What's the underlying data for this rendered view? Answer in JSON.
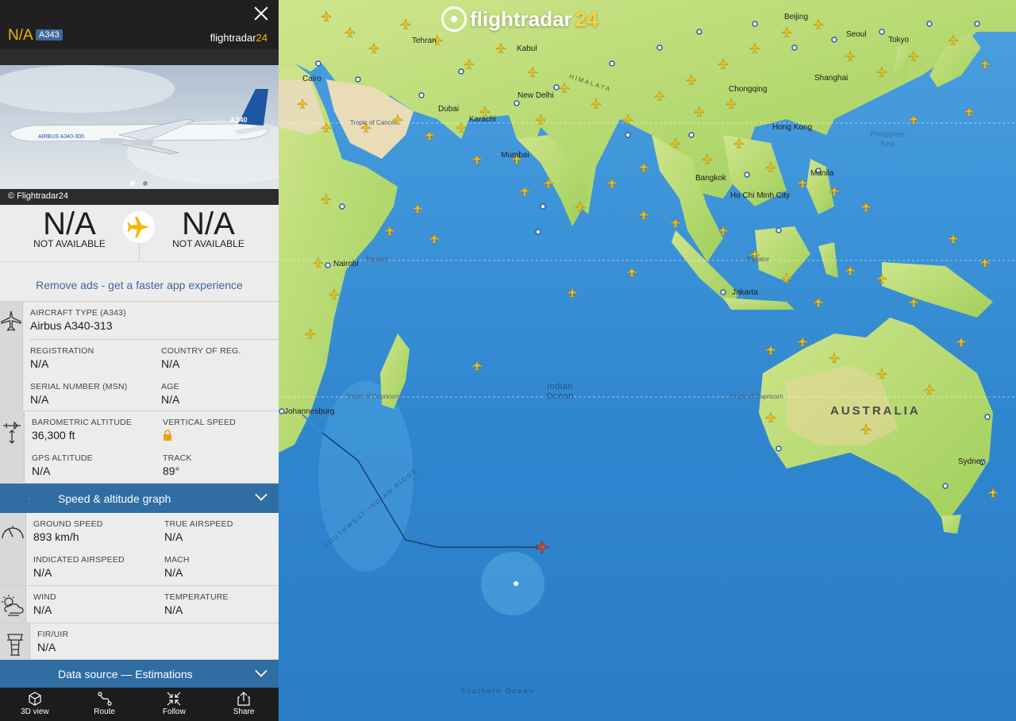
{
  "map": {
    "logo_text": "flightradar",
    "logo_num": "24",
    "cities": [
      {
        "name": "Tehran"
      },
      {
        "name": "Kabul"
      },
      {
        "name": "Cairo"
      },
      {
        "name": "Dubai"
      },
      {
        "name": "Karachi"
      },
      {
        "name": "New Delhi"
      },
      {
        "name": "Mumbai"
      },
      {
        "name": "Chongqing"
      },
      {
        "name": "Beijing"
      },
      {
        "name": "Seoul"
      },
      {
        "name": "Tokyo"
      },
      {
        "name": "Shanghai"
      },
      {
        "name": "Hong Kong"
      },
      {
        "name": "Manila"
      },
      {
        "name": "Bangkok"
      },
      {
        "name": "Ho Chi Minh City"
      },
      {
        "name": "Jakarta"
      },
      {
        "name": "Nairobi"
      },
      {
        "name": "Johannesburg"
      },
      {
        "name": "Sydney"
      }
    ],
    "oceans": {
      "indian": "Indian\nOcean",
      "southern": "Southern Ocean",
      "philippine": "Philippine\nSea"
    },
    "country_australia": "AUSTRALIA",
    "lines": {
      "equator": "Equator",
      "tropic_cancer": "Tropic of Cancer",
      "tropic_capricorn": "Tropic of Capricorn"
    },
    "ridge": "SOUTHWEST INDIAN RIDGE",
    "himalaya": "HIMALAYA"
  },
  "panel": {
    "callsign": "N/A",
    "aircraft_code": "A343",
    "brand_text": "flightradar",
    "brand_num": "24",
    "photo_credit": "© Flightradar24",
    "origin": {
      "code": "N/A",
      "name": "NOT AVAILABLE"
    },
    "destination": {
      "code": "N/A",
      "name": "NOT AVAILABLE"
    },
    "ads_link": "Remove ads - get a faster app experience",
    "aircraft": {
      "type_label": "AIRCRAFT TYPE (A343)",
      "type_value": "Airbus A340-313",
      "registration_label": "REGISTRATION",
      "registration_value": "N/A",
      "country_label": "COUNTRY OF REG.",
      "country_value": "N/A",
      "serial_label": "SERIAL NUMBER (MSN)",
      "serial_value": "N/A",
      "age_label": "AGE",
      "age_value": "N/A"
    },
    "altitude": {
      "baro_label": "BAROMETRIC ALTITUDE",
      "baro_value": "36,300 ft",
      "vs_label": "VERTICAL SPEED",
      "gps_label": "GPS ALTITUDE",
      "gps_value": "N/A",
      "track_label": "TRACK",
      "track_value": "89°"
    },
    "graph_bar": "Speed & altitude graph",
    "speed": {
      "gs_label": "GROUND SPEED",
      "gs_value": "893 km/h",
      "tas_label": "TRUE AIRSPEED",
      "tas_value": "N/A",
      "ias_label": "INDICATED AIRSPEED",
      "ias_value": "N/A",
      "mach_label": "MACH",
      "mach_value": "N/A"
    },
    "weather": {
      "wind_label": "WIND",
      "wind_value": "N/A",
      "temp_label": "TEMPERATURE",
      "temp_value": "N/A"
    },
    "fir": {
      "label": "FIR/UIR",
      "value": "N/A"
    },
    "source_bar": "Data source — Estimations",
    "tabs": [
      {
        "label": "3D view"
      },
      {
        "label": "Route"
      },
      {
        "label": "Follow"
      },
      {
        "label": "Share"
      }
    ]
  }
}
